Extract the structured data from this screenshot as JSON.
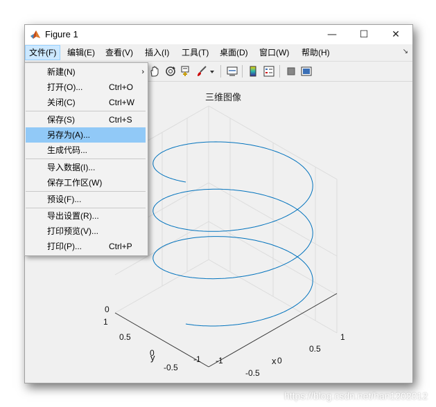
{
  "window": {
    "title": "Figure 1"
  },
  "titlebar_buttons": {
    "minimize": "—",
    "maximize": "☐",
    "close": "✕"
  },
  "menu": {
    "items": [
      "文件(F)",
      "编辑(E)",
      "查看(V)",
      "插入(I)",
      "工具(T)",
      "桌面(D)",
      "窗口(W)",
      "帮助(H)"
    ],
    "overflow": "↘"
  },
  "file_menu": {
    "items": [
      {
        "label": "新建(N)",
        "shortcut": "",
        "submenu": "›"
      },
      {
        "label": "打开(O)...",
        "shortcut": "Ctrl+O"
      },
      {
        "label": "关闭(C)",
        "shortcut": "Ctrl+W"
      },
      {
        "label": "保存(S)",
        "shortcut": "Ctrl+S"
      },
      {
        "label": "另存为(A)...",
        "shortcut": ""
      },
      {
        "label": "生成代码...",
        "shortcut": ""
      },
      {
        "label": "导入数据(I)...",
        "shortcut": ""
      },
      {
        "label": "保存工作区(W)",
        "shortcut": ""
      },
      {
        "label": "预设(F)...",
        "shortcut": ""
      },
      {
        "label": "导出设置(R)...",
        "shortcut": ""
      },
      {
        "label": "打印预览(V)...",
        "shortcut": ""
      },
      {
        "label": "打印(P)...",
        "shortcut": "Ctrl+P"
      }
    ],
    "highlighted_index": 4
  },
  "toolbar": {
    "icons": [
      "rotate-3d-icon",
      "pan-hand-icon",
      "rotate-icon",
      "data-cursor-icon",
      "brush-icon",
      "dropdown-arrow-icon",
      "link-plot-icon",
      "colorbar-icon",
      "legend-icon",
      "hide-plot-tools-icon",
      "show-plot-tools-icon"
    ]
  },
  "plot": {
    "title": "三维图像",
    "ticks": {
      "z_visible": [
        "0"
      ],
      "y": [
        "1",
        "0.5",
        "0",
        "-0.5",
        "-1"
      ],
      "x": [
        "1",
        "0.5",
        "0",
        "-0.5",
        "-1"
      ]
    },
    "xlabel": "x",
    "ylabel": "y",
    "line_color": "#0072bd"
  },
  "chart_data": {
    "type": "line",
    "subtype": "3d-helix",
    "title": "三维图像",
    "xlabel": "x",
    "ylabel": "y",
    "zlabel": "",
    "xlim": [
      -1,
      1
    ],
    "ylim": [
      -1,
      1
    ],
    "series": [
      {
        "x_expr": "sin(t)",
        "y_expr": "cos(t)",
        "z_expr": "t",
        "turns": 3
      }
    ],
    "grid": true
  },
  "watermark": "https://blog.csdn.net/han1202012"
}
